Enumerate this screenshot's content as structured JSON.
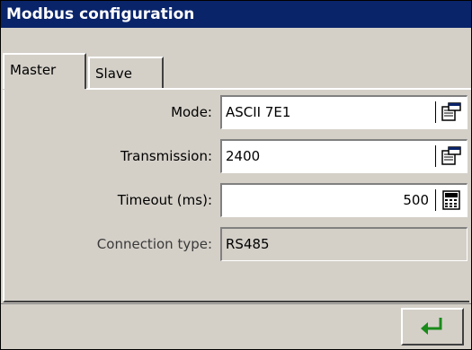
{
  "window": {
    "title": "Modbus configuration"
  },
  "tabs": [
    {
      "label": "Master",
      "active": true
    },
    {
      "label": "Slave",
      "active": false
    }
  ],
  "form": {
    "mode": {
      "label": "Mode:",
      "value": "ASCII 7E1",
      "icon": "properties-icon"
    },
    "transmission": {
      "label": "Transmission:",
      "value": "2400",
      "icon": "properties-icon"
    },
    "timeout": {
      "label": "Timeout (ms):",
      "value": "500",
      "icon": "calculator-icon"
    },
    "connection_type": {
      "label": "Connection type:",
      "value": "RS485"
    }
  },
  "footer": {
    "enter_icon": "enter-arrow-icon",
    "enter_color": "#1a8a1a"
  },
  "colors": {
    "titlebar": "#0a246a",
    "face": "#d4d0c8"
  }
}
